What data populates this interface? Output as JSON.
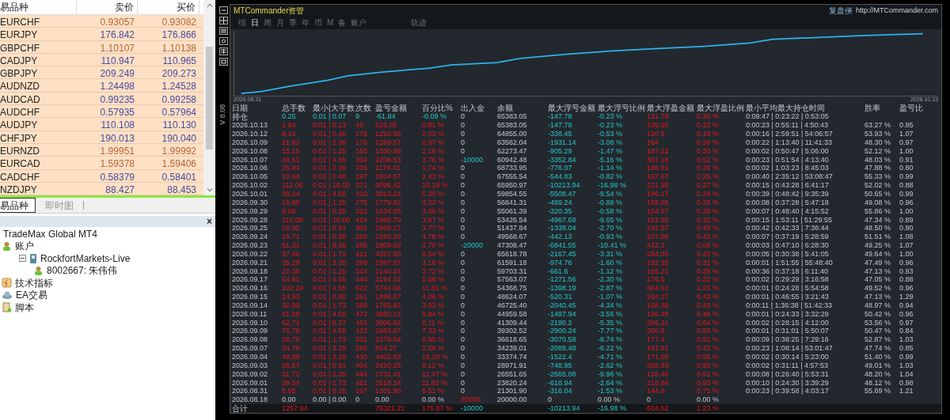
{
  "market_watch": {
    "columns": [
      "易品种",
      "卖价",
      "买价"
    ],
    "rows": [
      {
        "symbol": "EURCHF",
        "bid": "0.93057",
        "ask": "0.93082",
        "falling": true
      },
      {
        "symbol": "EURJPY",
        "bid": "176.842",
        "ask": "176.866",
        "falling": false
      },
      {
        "symbol": "GBPCHF",
        "bid": "1.10107",
        "ask": "1.10138",
        "falling": true
      },
      {
        "symbol": "CADJPY",
        "bid": "110.947",
        "ask": "110.965",
        "falling": false
      },
      {
        "symbol": "GBPJPY",
        "bid": "209.249",
        "ask": "209.273",
        "falling": false
      },
      {
        "symbol": "AUDNZD",
        "bid": "1.24498",
        "ask": "1.24528",
        "falling": false
      },
      {
        "symbol": "AUDCAD",
        "bid": "0.99235",
        "ask": "0.99258",
        "falling": false
      },
      {
        "symbol": "AUDCHF",
        "bid": "0.57935",
        "ask": "0.57964",
        "falling": false
      },
      {
        "symbol": "AUDJPY",
        "bid": "110.108",
        "ask": "110.130",
        "falling": false
      },
      {
        "symbol": "CHFJPY",
        "bid": "190.013",
        "ask": "190.040",
        "falling": false
      },
      {
        "symbol": "EURNZD",
        "bid": "1.99951",
        "ask": "1.99992",
        "falling": true
      },
      {
        "symbol": "EURCAD",
        "bid": "1.59378",
        "ask": "1.59406",
        "falling": true
      },
      {
        "symbol": "CADCHF",
        "bid": "0.58379",
        "ask": "0.58401",
        "falling": false
      },
      {
        "symbol": "NZDJPY",
        "bid": "88.427",
        "ask": "88.453",
        "falling": false
      }
    ]
  },
  "bottom_tabs": [
    {
      "label": "易品种",
      "selected": true
    },
    {
      "label": "即时图",
      "selected": false
    }
  ],
  "navigator": {
    "close": "×",
    "tree": [
      {
        "label": "TradeMax Global MT4",
        "kind": "root"
      },
      {
        "label": "账户",
        "kind": "accounts",
        "children": [
          {
            "label": "RockfortMarkets-Live",
            "kind": "server",
            "children": [
              {
                "label": "8002667: 朱伟伟",
                "kind": "account"
              }
            ]
          }
        ]
      },
      {
        "label": "技术指标",
        "kind": "indicators"
      },
      {
        "label": "EA交易",
        "kind": "experts"
      },
      {
        "label": "脚本",
        "kind": "scripts"
      }
    ]
  },
  "commander": {
    "title": "MTCommander资管",
    "brand": "复盘侠",
    "url": "http://MTCommander.com",
    "version": "V 8.08",
    "tabs": [
      {
        "label": "综",
        "selected": false
      },
      {
        "label": "日",
        "selected": true
      },
      {
        "label": "周",
        "selected": false
      },
      {
        "label": "月",
        "selected": false
      },
      {
        "label": "季",
        "selected": false
      },
      {
        "label": "年",
        "selected": false
      },
      {
        "label": "币",
        "selected": false
      },
      {
        "label": "M",
        "selected": false
      },
      {
        "label": "备",
        "selected": false
      },
      {
        "label": "账户",
        "selected": false
      },
      {
        "label": "轨迹",
        "selected": false
      }
    ],
    "chart": {
      "start_label": "2026.08.31",
      "end_label": "2026.10.13"
    },
    "table": {
      "columns": [
        "日期",
        "总手数",
        "最小|大手数",
        "次数",
        "盈亏金额",
        "百分比%",
        "出入金",
        "余额",
        "最大浮亏金额",
        "最大浮亏比例",
        "最大浮盈金额",
        "最大浮盈比例",
        "最小平均最大持仓时间",
        "胜率",
        "盈亏比"
      ],
      "rows": [
        {
          "kind": "position",
          "outflow": false,
          "inflow": false,
          "cells": [
            "持仓",
            "0.25",
            "0.01 | 0.07",
            "9",
            "-61.84",
            "-0.09 %",
            "0",
            "65383.05",
            "-147.78",
            "-0.23 %",
            "131.79",
            "0.20 %",
            "0:09:47 | 0:23:22 | 0:53:05"
          ]
        },
        {
          "kind": "day",
          "outflow": false,
          "inflow": false,
          "cells": [
            "2026.10.13",
            "1.84",
            "0.01 | 0.13",
            "49",
            "528.05",
            "0.81 %",
            "0",
            "65383.05",
            "-147.78",
            "-0.23 %",
            "139.66",
            "0.22 %",
            "0:00:23 | 0:55:11 | 4:50:43",
            "63.27 %",
            "0.95"
          ]
        },
        {
          "kind": "day",
          "outflow": false,
          "inflow": false,
          "cells": [
            "2026.10.12",
            "8.15",
            "0.01 | 0.48",
            "178",
            "1292.96",
            "2.03 %",
            "0",
            "64855.00",
            "-338.45",
            "-0.53 %",
            "120.5",
            "0.19 %",
            "0:00:16 | 2:59:51 | 54:06:57",
            "53.93 %",
            "1.07"
          ]
        },
        {
          "kind": "day",
          "outflow": false,
          "inflow": false,
          "cells": [
            "2026.10.09",
            "21.82",
            "0.01 | 2.39",
            "176",
            "1289.57",
            "2.07 %",
            "0",
            "63562.04",
            "-1931.14",
            "-3.08 %",
            "164",
            "0.26 %",
            "0:00:22 | 1:13:40 | 11:41:33",
            "48.30 %",
            "0.97"
          ]
        },
        {
          "kind": "day",
          "outflow": false,
          "inflow": false,
          "cells": [
            "2026.10.08",
            "15.15",
            "0.01 | 1.25",
            "165",
            "1330.99",
            "2.18 %",
            "0",
            "62273.47",
            "-905.29",
            "-1.47 %",
            "187.22",
            "0.30 %",
            "0:00:02 | 0:50:47 | 5:06:00",
            "52.12 %",
            "1.00"
          ]
        },
        {
          "kind": "day",
          "outflow": true,
          "inflow": false,
          "cells": [
            "2026.10.07",
            "49.51",
            "0.01 | 4.55",
            "304",
            "2208.53",
            "3.76 %",
            "-10000",
            "60942.48",
            "-3352.84",
            "-5.16 %",
            "307.18",
            "0.52 %",
            "0:00:23 | 0:51:54 | 4:13:40",
            "48.03 %",
            "0.91"
          ]
        },
        {
          "kind": "day",
          "outflow": false,
          "inflow": false,
          "cells": [
            "2026.10.06",
            "25.84",
            "0.01 | 2.39",
            "236",
            "1178.41",
            "1.74 %",
            "0",
            "68733.95",
            "-776.07",
            "-1.14 %",
            "188.91",
            "0.28 %",
            "0:00:02 | 1:03:23 | 8:45:03",
            "47.88 %",
            "0.80"
          ]
        },
        {
          "kind": "day",
          "outflow": false,
          "inflow": false,
          "cells": [
            "2026.10.05",
            "10.64",
            "0.01 | 0.48",
            "197",
            "1604.57",
            "2.43 %",
            "0",
            "67555.54",
            "-544.83",
            "-0.82 %",
            "167.67",
            "0.25 %",
            "0:00:40 | 2:35:12 | 53:08:47",
            "55.33 %",
            "0.99"
          ]
        },
        {
          "kind": "day",
          "outflow": false,
          "inflow": false,
          "cells": [
            "2026.10.02",
            "112.06",
            "0.01 | 10.00",
            "371",
            "6096.42",
            "10.19 %",
            "0",
            "65950.97",
            "-10213.94",
            "-16.98 %",
            "221.98",
            "0.37 %",
            "0:00:15 | 0:43:28 | 6:41:17",
            "52.02 %",
            "0.88"
          ]
        },
        {
          "kind": "day",
          "outflow": false,
          "inflow": false,
          "cells": [
            "2026.10.01",
            "39.14",
            "0.01 | 4.55",
            "310",
            "3013.24",
            "5.30 %",
            "0",
            "59854.55",
            "-5508.47",
            "-9.54 %",
            "196.17",
            "0.34 %",
            "0:00:39 | 0:48:42 | 9:35:39",
            "50.65 %",
            "0.99"
          ]
        },
        {
          "kind": "day",
          "outflow": false,
          "inflow": false,
          "cells": [
            "2026.09.30",
            "19.80",
            "0.01 | 1.25",
            "275",
            "1779.92",
            "3.23 %",
            "0",
            "56841.31",
            "-489.24",
            "-0.88 %",
            "155.05",
            "0.29 %",
            "0:00:08 | 0:37:28 | 5:47:18",
            "49.08 %",
            "0.96"
          ]
        },
        {
          "kind": "day",
          "outflow": false,
          "inflow": false,
          "cells": [
            "2026.09.29",
            "9.06",
            "0.01 | 0.25",
            "222",
            "1634.85",
            "3.06 %",
            "0",
            "55061.39",
            "-320.35",
            "-0.58 %",
            "154.57",
            "0.29 %",
            "0:00:07 | 0:48:40 | 4:15:52",
            "55.86 %",
            "1.00"
          ]
        },
        {
          "kind": "day",
          "outflow": false,
          "inflow": false,
          "cells": [
            "2026.09.28",
            "116.00",
            "0.01 | 10.00",
            "414",
            "1988.70",
            "3.87 %",
            "0",
            "53426.54",
            "-4967.68",
            "-9.65 %",
            "161.95",
            "0.32 %",
            "0:00:15 | 1:53:11 | 51:29:55",
            "47.34 %",
            "0.89"
          ]
        },
        {
          "kind": "day",
          "outflow": false,
          "inflow": false,
          "cells": [
            "2026.09.25",
            "26.90",
            "0.01 | 0.91",
            "301",
            "1868.17",
            "3.77 %",
            "0",
            "51437.84",
            "-1338.04",
            "-2.70 %",
            "242.57",
            "0.49 %",
            "0:00:42 | 0:42:33 | 7:36:44",
            "48.50 %",
            "0.90"
          ]
        },
        {
          "kind": "day",
          "outflow": false,
          "inflow": false,
          "cells": [
            "2026.09.24",
            "15.71",
            "0.01 | 0.68",
            "299",
            "2260.20",
            "4.78 %",
            "0",
            "49568.67",
            "-442.13",
            "-0.93 %",
            "207.08",
            "0.42 %",
            "0:00:07 | 0:37:19 | 5:28:59",
            "51.51 %",
            "1.08"
          ]
        },
        {
          "kind": "day",
          "outflow": true,
          "inflow": false,
          "cells": [
            "2026.09.23",
            "51.31",
            "0.01 | 8.66",
            "286",
            "1809.69",
            "3.70 %",
            "-20000",
            "47308.47",
            "-6841.55",
            "-10.41 %",
            "432.3",
            "0.66 %",
            "0:00:03 | 0:47:10 | 6:28:30",
            "49.25 %",
            "1.07"
          ]
        },
        {
          "kind": "day",
          "outflow": false,
          "inflow": false,
          "cells": [
            "2026.09.22",
            "37.46",
            "0.01 | 1.73",
            "421",
            "4027.60",
            "6.54 %",
            "0",
            "65618.78",
            "-2167.45",
            "-3.31 %",
            "284.05",
            "0.43 %",
            "0:00:05 | 0:30:38 | 5:41:05",
            "49.64 %",
            "1.00"
          ]
        },
        {
          "kind": "day",
          "outflow": false,
          "inflow": false,
          "cells": [
            "2026.09.21",
            "35.29",
            "0.01 | 3.20",
            "299",
            "1987.87",
            "3.16 %",
            "0",
            "61591.18",
            "-974.76",
            "-1.60 %",
            "192.35",
            "0.31 %",
            "0:00:01 | 1:51:55 | 55:48:40",
            "47.49 %",
            "0.96"
          ]
        },
        {
          "kind": "day",
          "outflow": false,
          "inflow": false,
          "cells": [
            "2026.09.18",
            "22.38",
            "0.01 | 1.25",
            "314",
            "2140.24",
            "3.72 %",
            "0",
            "59703.31",
            "-661.6",
            "-1.12 %",
            "165.21",
            "0.28 %",
            "0:00:36 | 0:37:18 | 6:11:40",
            "47.13 %",
            "0.93"
          ]
        },
        {
          "kind": "day",
          "outflow": false,
          "inflow": false,
          "cells": [
            "2026.09.17",
            "64.61",
            "0.01 | 4.55",
            "440",
            "3194.32",
            "5.88 %",
            "0",
            "57563.07",
            "-1271.56",
            "-2.30 %",
            "176.5",
            "0.32 %",
            "0:00:02 | 0:29:29 | 3:16:58",
            "47.05 %",
            "0.88"
          ]
        },
        {
          "kind": "day",
          "outflow": false,
          "inflow": false,
          "cells": [
            "2026.09.16",
            "102.24",
            "0.01 | 4.55",
            "622",
            "5744.66",
            "11.81 %",
            "0",
            "54368.75",
            "-1398.19",
            "-2.87 %",
            "604.62",
            "1.23 %",
            "0:00:01 | 0:24:28 | 5:54:58",
            "49.52 %",
            "0.96"
          ]
        },
        {
          "kind": "day",
          "outflow": false,
          "inflow": false,
          "cells": [
            "2026.09.15",
            "14.93",
            "0.01 | 0.86",
            "261",
            "1898.67",
            "4.06 %",
            "0",
            "48624.07",
            "-520.31",
            "-1.07 %",
            "204.27",
            "0.43 %",
            "0:00:01 | 0:46:55 | 3:21:43",
            "47.13 %",
            "1.29"
          ]
        },
        {
          "kind": "day",
          "outflow": false,
          "inflow": false,
          "cells": [
            "2026.09.14",
            "32.99",
            "0.01 | 1.73",
            "388",
            "1765.82",
            "3.93 %",
            "0",
            "46725.40",
            "-2040.45",
            "-4.34 %",
            "198.38",
            "0.43 %",
            "0:00:11 | 1:36:38 | 51:42:33",
            "48.97 %",
            "0.94"
          ]
        },
        {
          "kind": "day",
          "outflow": false,
          "inflow": false,
          "cells": [
            "2026.09.11",
            "61.98",
            "0.01 | 4.55",
            "472",
            "3650.14",
            "8.84 %",
            "0",
            "44959.58",
            "-1497.94",
            "-3.56 %",
            "190.48",
            "0.46 %",
            "0:00:01 | 0:24:33 | 3:32:29",
            "50.42 %",
            "0.96"
          ]
        },
        {
          "kind": "day",
          "outflow": false,
          "inflow": false,
          "cells": [
            "2026.09.10",
            "62.71",
            "0.01 | 6.27",
            "463",
            "3006.92",
            "8.11 %",
            "0",
            "41309.44",
            "-2190.2",
            "-5.35 %",
            "256.31",
            "0.64 %",
            "0:00:02 | 0:28:15 | 4:12:00",
            "53.56 %",
            "0.97"
          ]
        },
        {
          "kind": "day",
          "outflow": false,
          "inflow": false,
          "cells": [
            "2026.09.09",
            "78.78",
            "0.01 | 4.55",
            "422",
            "2683.87",
            "7.33 %",
            "0",
            "39302.52",
            "-2900.24",
            "-7.77 %",
            "300.8",
            "0.83 %",
            "0:00:01 | 0:31:01 | 5:50:07",
            "50.47 %",
            "0.84"
          ]
        },
        {
          "kind": "day",
          "outflow": false,
          "inflow": false,
          "cells": [
            "2026.09.08",
            "28.78",
            "0.01 | 1.73",
            "331",
            "2379.64",
            "6.95 %",
            "0",
            "36618.65",
            "-3070.58",
            "-8.74 %",
            "177.4",
            "0.51 %",
            "0:00:09 | 0:38:25 | 7:29:16",
            "52.87 %",
            "1.03"
          ]
        },
        {
          "kind": "day",
          "outflow": false,
          "inflow": false,
          "cells": [
            "2026.09.07",
            "34.78",
            "0.01 | 3.29",
            "266",
            "864.27",
            "2.59 %",
            "0",
            "34239.01",
            "-2088.48",
            "-6.22 %",
            "141.91",
            "0.42 %",
            "0:00:23 | 1:08:14 | 53:01:47",
            "47.74 %",
            "0.85"
          ]
        },
        {
          "kind": "day",
          "outflow": false,
          "inflow": false,
          "cells": [
            "2026.09.04",
            "49.99",
            "0.01 | 3.29",
            "430",
            "4402.83",
            "15.20 %",
            "0",
            "33374.74",
            "-1522.4",
            "-4.71 %",
            "171.08",
            "0.56 %",
            "0:00:02 | 0:30:14 | 5:23:00",
            "51.40 %",
            "0.99"
          ]
        },
        {
          "kind": "day",
          "outflow": false,
          "inflow": false,
          "cells": [
            "2026.09.03",
            "26.57",
            "0.01 | 0.91",
            "404",
            "2420.26",
            "9.12 %",
            "0",
            "28971.91",
            "-748.95",
            "-2.62 %",
            "255.93",
            "0.93 %",
            "0:00:02 | 0:31:11 | 4:57:53",
            "49.01 %",
            "1.03"
          ]
        },
        {
          "kind": "day",
          "outflow": false,
          "inflow": false,
          "cells": [
            "2026.09.02",
            "31.72",
            "0.01 | 2.39",
            "444",
            "2731.41",
            "11.47 %",
            "0",
            "26551.65",
            "-2565.08",
            "-9.96 %",
            "126.46",
            "0.51 %",
            "0:00:08 | 0:26:40 | 5:53:31",
            "48.20 %",
            "1.04"
          ]
        },
        {
          "kind": "day",
          "outflow": false,
          "inflow": false,
          "cells": [
            "2026.09.01",
            "39.54",
            "0.01 | 1.73",
            "451",
            "2518.34",
            "11.82 %",
            "0",
            "23820.24",
            "-618.94",
            "-2.64 %",
            "218.84",
            "0.93 %",
            "0:00:10 | 0:24:30 | 3:39:29",
            "48.12 %",
            "0.98"
          ]
        },
        {
          "kind": "day",
          "outflow": false,
          "inflow": false,
          "cells": [
            "2026.08.31",
            "6.95",
            "0.01 | 0.35",
            "167",
            "1301.90",
            "6.51 %",
            "0",
            "21301.90",
            "-316.04",
            "-1.53 %",
            "144.6",
            "0.71 %",
            "0:00:23 | 0:39:58 | 4:03:17",
            "55.69 %",
            "1.21"
          ]
        },
        {
          "kind": "initial",
          "outflow": false,
          "inflow": true,
          "cells": [
            "2026.08.18",
            "0.00",
            "0.00 | 0.00",
            "0",
            "0.00",
            "0.00 %",
            "20000",
            "20000.00",
            "0",
            "0.00 %",
            "0",
            "0.00 %"
          ]
        },
        {
          "kind": "total",
          "outflow": true,
          "inflow": false,
          "cells": [
            "合计",
            "1257.94",
            "",
            "",
            "75321.21",
            "176.87 %",
            "-10000",
            "",
            "-10213.94",
            "-16.98 %",
            "604.62",
            "1.23 %"
          ]
        }
      ]
    }
  }
}
